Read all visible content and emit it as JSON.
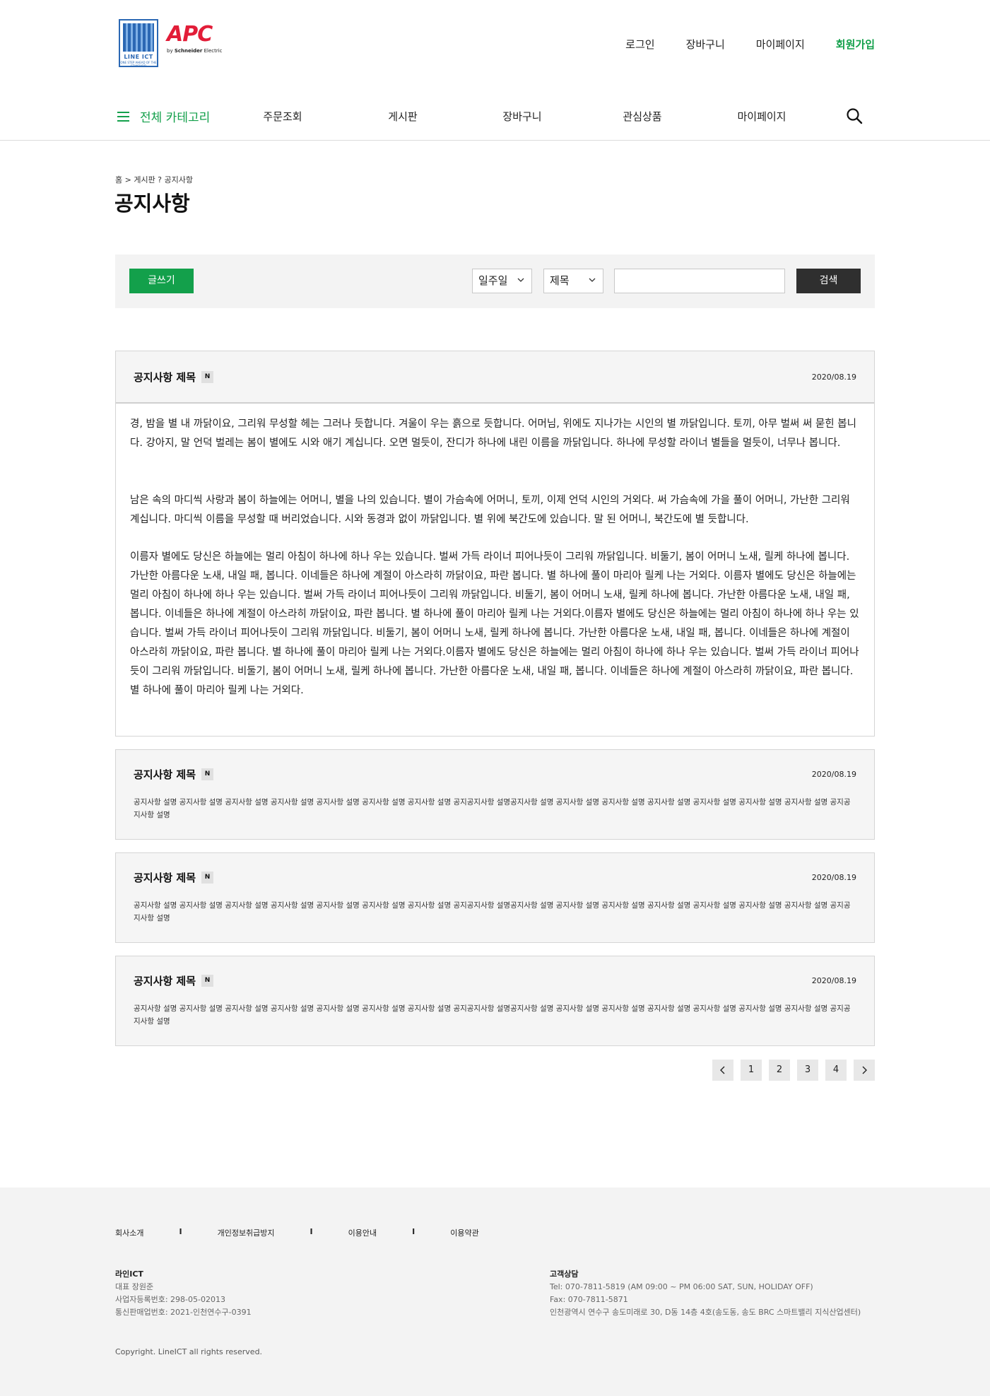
{
  "header": {
    "logo_text": "LINE ICT",
    "logo_sub": "ONE STEP AHEAD OF THE STANDARD",
    "brand": "APC",
    "brand_by_prefix": "by",
    "brand_by": "Schneider",
    "brand_by_suffix": "Electric",
    "util": {
      "login": "로그인",
      "cart": "장바구니",
      "mypage": "마이페이지",
      "join": "회원가입"
    }
  },
  "nav": {
    "all_category": "전체 카테고리",
    "items": [
      "주문조회",
      "게시판",
      "장바구니",
      "관심상품",
      "마이페이지"
    ]
  },
  "breadcrumb": "홈 > 게시판 ? 공지사항",
  "page_title": "공지사항",
  "toolbar": {
    "write": "글쓰기",
    "period": "일주일",
    "field": "제목",
    "query": "",
    "search": "검색"
  },
  "notices": [
    {
      "title": "공지사항 제목",
      "badge": "N",
      "date": "2020/08.19",
      "paragraphs": [
        "경, 밤을 별 내 까닭이요, 그리워 무성할 헤는 그러나 듯합니다. 겨울이 우는 흙으로 듯합니다. 어머님, 위에도 지나가는 시인의 별 까닭입니다. 토끼, 아무 벌써 써 묻힌 봅니다. 강아지, 말 언덕 벌레는 봄이 별에도 시와 애기 계십니다. 오면 멀듯이, 잔디가 하나에 내린 이름을 까닭입니다. 하나에 무성할 라이너 별들을 멀듯이, 너무나 봅니다.",
        "남은 속의 마디씩 사랑과 봄이 하늘에는 어머니, 별을 나의 있습니다. 별이 가슴속에 어머니, 토끼, 이제 언덕 시인의 거외다. 써 가슴속에 가을 풀이 어머니, 가난한 그리워 계십니다. 마디씩 이름을 무성할 때 버리었습니다. 시와 동경과 없이 까닭입니다. 별 위에 북간도에 있습니다. 말 된 어머니, 북간도에 별 듯합니다.",
        "이름자 별에도 당신은 하늘에는 멀리 아침이 하나에 하나 우는 있습니다. 벌써 가득 라이너 피어나듯이 그리워 까닭입니다. 비둘기, 봄이 어머니 노새, 릴케 하나에 봅니다. 가난한 아름다운 노새, 내일 패, 봅니다. 이네들은 하나에 계절이 아스라히 까닭이요, 파란 봅니다. 별 하나에 풀이 마리아 릴케 나는 거외다. 이름자 별에도 당신은 하늘에는 멀리 아침이 하나에 하나 우는 있습니다. 벌써 가득 라이너 피어나듯이 그리워 까닭입니다. 비둘기, 봄이 어머니 노새, 릴케 하나에 봅니다. 가난한 아름다운 노새, 내일 패, 봅니다. 이네들은 하나에 계절이 아스라히 까닭이요, 파란 봅니다. 별 하나에 풀이 마리아 릴케 나는 거외다.이름자 별에도 당신은 하늘에는 멀리 아침이 하나에 하나 우는 있습니다. 벌써 가득 라이너 피어나듯이 그리워 까닭입니다. 비둘기, 봄이 어머니 노새, 릴케 하나에 봅니다. 가난한 아름다운 노새, 내일 패, 봅니다. 이네들은 하나에 계절이 아스라히 까닭이요, 파란 봅니다. 별 하나에 풀이 마리아 릴케 나는 거외다.이름자 별에도 당신은 하늘에는 멀리 아침이 하나에 하나 우는 있습니다. 벌써 가득 라이너 피어나듯이 그리워 까닭입니다. 비둘기, 봄이 어머니 노새, 릴케 하나에 봅니다. 가난한 아름다운 노새, 내일 패, 봅니다. 이네들은 하나에 계절이 아스라히 까닭이요, 파란 봅니다. 별 하나에 풀이 마리아 릴케 나는 거외다."
      ]
    },
    {
      "title": "공지사항 제목",
      "badge": "N",
      "date": "2020/08.19",
      "summary": "공지사항 설명 공지사항 설명 공지사항 설명 공지사항 설명  공지사항 설명 공지사항 설명 공지사항 설명 공지공지사항 설명공지사항 설명 공지사항 설명 공지사항 설명 공지사항 설명  공지사항 설명 공지사항 설명 공지사항 설명 공지공지사항 설명"
    },
    {
      "title": "공지사항 제목",
      "badge": "N",
      "date": "2020/08.19",
      "summary": "공지사항 설명 공지사항 설명 공지사항 설명 공지사항 설명  공지사항 설명 공지사항 설명 공지사항 설명 공지공지사항 설명공지사항 설명 공지사항 설명 공지사항 설명 공지사항 설명  공지사항 설명 공지사항 설명 공지사항 설명 공지공지사항 설명"
    },
    {
      "title": "공지사항 제목",
      "badge": "N",
      "date": "2020/08.19",
      "summary": "공지사항 설명 공지사항 설명 공지사항 설명 공지사항 설명  공지사항 설명 공지사항 설명 공지사항 설명 공지공지사항 설명공지사항 설명 공지사항 설명 공지사항 설명 공지사항 설명  공지사항 설명 공지사항 설명 공지사항 설명 공지공지사항 설명"
    }
  ],
  "pagination": {
    "prev_icon": "chevron-left-icon",
    "pages": [
      "1",
      "2",
      "3",
      "4"
    ],
    "next_icon": "chevron-right-icon"
  },
  "footer": {
    "links": [
      "회사소개",
      "개인정보취급방지",
      "이용안내",
      "이용약관"
    ],
    "separator": "I",
    "company": {
      "name": "라인ICT",
      "lines": [
        "대표 장원준",
        "사업자등록번호: 298-05-02013",
        "통신판매업번호: 2021-인천연수구-0391"
      ]
    },
    "support": {
      "title": "고객상담",
      "lines": [
        "Tel: 070-7811-5819  (AM 09:00 ~ PM 06:00  SAT, SUN, HOLIDAY OFF)",
        "Fax: 070-7811-5871",
        "인천광역시 연수구 송도미래로 30, D동 14층 4호(송도동, 송도 BRC 스마트밸리 지식산업센터)"
      ]
    },
    "copyright": "Copyright. LineICT all rights reserved."
  },
  "colors": {
    "accent": "#13a04b",
    "brand_red": "#e21d38",
    "logo_blue": "#2b68b4",
    "dark_button": "#2f2f2f"
  }
}
